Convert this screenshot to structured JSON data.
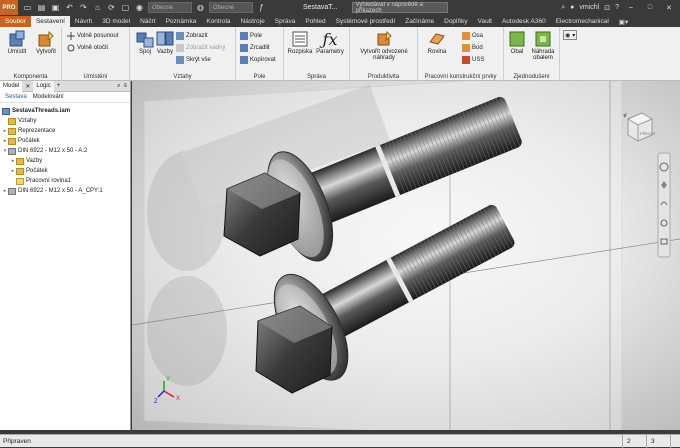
{
  "title_bar": {
    "logo": "PRO",
    "appearance_combo": "Obecné",
    "material_combo": "Obecné",
    "window_title": "SestavaT...",
    "search_placeholder": "Vyhledávat v nápovědě a příkazech",
    "user": "vmichl",
    "help": "?"
  },
  "tabs": [
    {
      "label": "Soubor"
    },
    {
      "label": "Sestavení"
    },
    {
      "label": "Návrh"
    },
    {
      "label": "3D model"
    },
    {
      "label": "Náčrt"
    },
    {
      "label": "Poznámka"
    },
    {
      "label": "Kontrola"
    },
    {
      "label": "Nástroje"
    },
    {
      "label": "Správa"
    },
    {
      "label": "Pohled"
    },
    {
      "label": "Systémové prostředí"
    },
    {
      "label": "Začínáme"
    },
    {
      "label": "Doplňky"
    },
    {
      "label": "Vault"
    },
    {
      "label": "Autodesk A360"
    },
    {
      "label": "Electromechanical"
    }
  ],
  "ribbon": {
    "komponenta": {
      "title": "Komponenta",
      "umistit": "Umístit",
      "vytvorit": "Vytvořit"
    },
    "umisteni": {
      "title": "Umístění",
      "volne_posunout": "Volně posunout",
      "volne_otocit": "Volně otočit"
    },
    "vztahy": {
      "title": "Vztahy",
      "spoj": "Spoj",
      "vazby": "Vazby",
      "zobrazit": "Zobrazit",
      "zobrazit_vadny": "Zobrazit vadný",
      "skryt_vse": "Skrýt vše"
    },
    "pole": {
      "title": "Pole",
      "pole": "Pole",
      "zrcadlit": "Zrcadlit",
      "kopirovat": "Kopírovat"
    },
    "sprava": {
      "title": "Správa",
      "rozpiska": "Rozpiska",
      "parametry": "Parametry"
    },
    "produktivita": {
      "title": "Produktivita",
      "vytvorit_odvozene": "Vytvořit odvozené",
      "nahrady": "náhrady"
    },
    "pracovni": {
      "title": "Pracovní konstrukční prvky",
      "rovina": "Rovina",
      "osa": "Osa",
      "bod": "Bod",
      "uss": "USS"
    },
    "zjednoduseni": {
      "title": "Zjednodušení",
      "obal": "Obal",
      "nahrada_obalem": "Náhrada",
      "obalem": "obalem"
    }
  },
  "browser": {
    "tab_model": "Model",
    "tab_logic": "Logic",
    "sub_sestava": "Sestava",
    "sub_modelovani": "Modelování",
    "tree": [
      {
        "label": "SestavaThreads.iam",
        "icon": "assembly-icon"
      },
      {
        "label": "Vztahy",
        "icon": "folder-icon"
      },
      {
        "label": "Reprezentace",
        "icon": "folder-icon"
      },
      {
        "label": "Počátek",
        "icon": "folder-icon"
      },
      {
        "label": "DIN 6922 - M12 x 50 - A:2",
        "icon": "part-icon"
      },
      {
        "label": "Vazby",
        "icon": "folder-icon"
      },
      {
        "label": "Počátek",
        "icon": "folder-icon"
      },
      {
        "label": "Pracovní rovina1",
        "icon": "plane-icon"
      },
      {
        "label": "DIN 6922 - M12 x 50 - A_CPY:1",
        "icon": "part-icon"
      }
    ]
  },
  "viewcube": {
    "face_front": "PŘEDNÍ",
    "face_top": "HORNÍ"
  },
  "triad": {
    "x": "X",
    "y": "Y",
    "z": "Z"
  },
  "status": {
    "message": "Připraven",
    "count1": "2",
    "count2": "3"
  }
}
